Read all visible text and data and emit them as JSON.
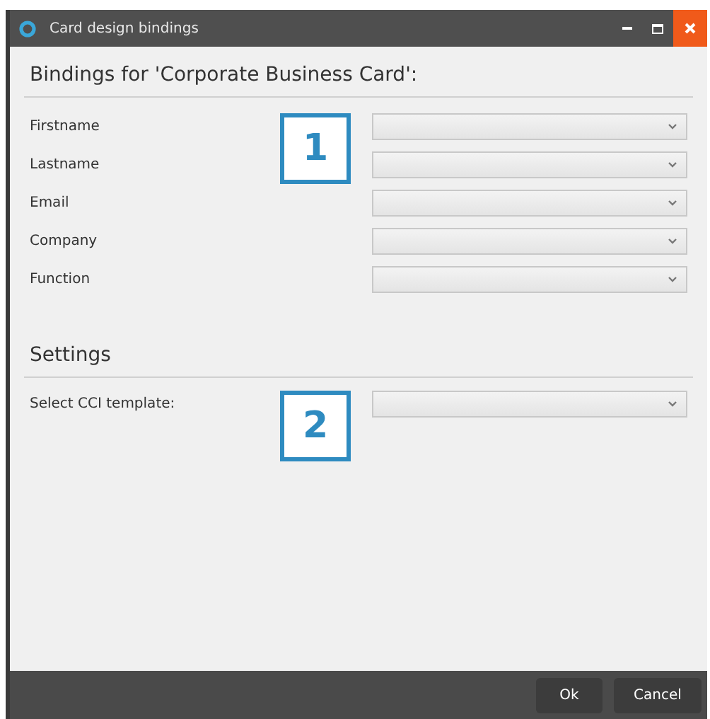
{
  "window": {
    "title": "Card design bindings"
  },
  "bindings": {
    "heading": "Bindings for 'Corporate Business Card':",
    "fields": [
      {
        "label": "Firstname"
      },
      {
        "label": "Lastname"
      },
      {
        "label": "Email"
      },
      {
        "label": "Company"
      },
      {
        "label": "Function"
      }
    ]
  },
  "settings": {
    "heading": "Settings",
    "fields": [
      {
        "label": "Select CCI template:"
      }
    ]
  },
  "callouts": [
    "1",
    "2"
  ],
  "buttons": [
    "Ok",
    "Cancel"
  ]
}
